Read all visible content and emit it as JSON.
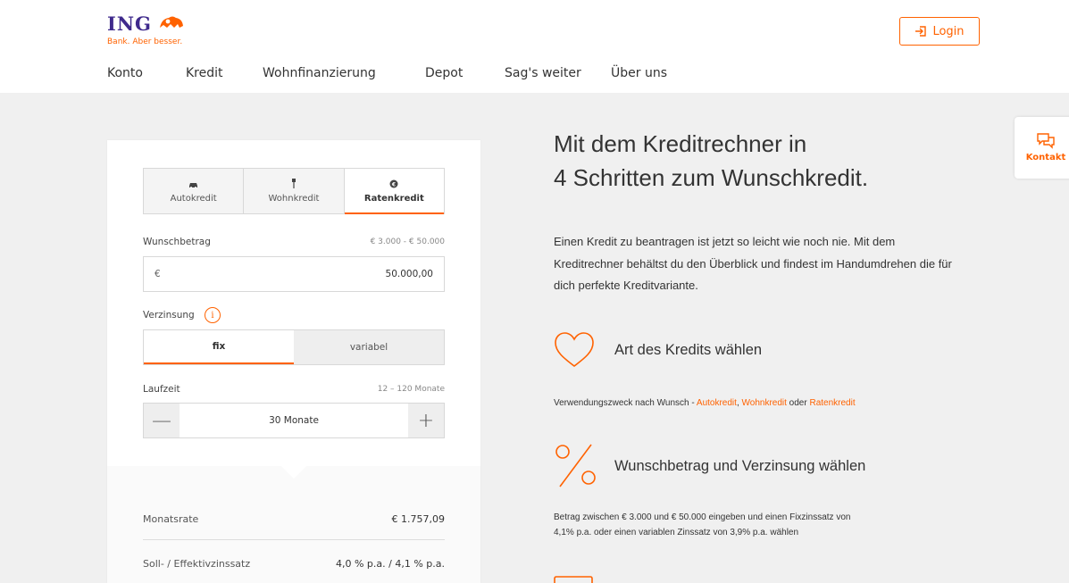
{
  "brand": {
    "name": "ING",
    "tagline": "Bank. Aber besser.",
    "accent": "#ff6200",
    "navy": "#3f2a8c"
  },
  "header": {
    "login_label": "Login",
    "nav": [
      "Konto",
      "Kredit",
      "Wohnfinanzierung",
      "Depot",
      "Sag's weiter",
      "Über uns"
    ]
  },
  "calculator": {
    "tabs": [
      {
        "label": "Autokredit",
        "icon": "car-icon"
      },
      {
        "label": "Wohnkredit",
        "icon": "home-icon"
      },
      {
        "label": "Ratenkredit",
        "icon": "coin-icon",
        "selected": true
      }
    ],
    "amount": {
      "label": "Wunschbetrag",
      "range": "€ 3.000 - € 50.000",
      "currency": "€",
      "value": "50.000,00"
    },
    "interest": {
      "label": "Verzinsung",
      "info": "i",
      "options": [
        "fix",
        "variabel"
      ],
      "selected": "fix"
    },
    "term": {
      "label": "Laufzeit",
      "range": "12 – 120 Monate",
      "value": "30 Monate",
      "minus": "—",
      "plus": "+"
    },
    "results": [
      {
        "label": "Monatsrate",
        "value": "€ 1.757,09"
      },
      {
        "label": "Soll- / Effektivzinssatz",
        "value": "4,0 % p.a. / 4,1 % p.a."
      }
    ]
  },
  "content": {
    "headline_1": "Mit dem Kreditrechner in",
    "headline_2": "4 Schritten zum Wunschkredit.",
    "intro": "Einen Kredit zu beantragen ist jetzt so leicht wie noch nie. Mit dem Kreditrechner behältst du den Überblick und findest im Handumdrehen die für dich perfekte Kreditvariante.",
    "step1": {
      "title": "Art des Kredits wählen",
      "desc_prefix": "Verwendungszweck nach Wunsch - ",
      "link1": "Autokredit",
      "sep1": ", ",
      "link2": "Wohnkredit",
      "sep2": " oder ",
      "link3": "Ratenkredit"
    },
    "step2": {
      "title": "Wunschbetrag und Verzinsung wählen",
      "desc_line1": "Betrag zwischen € 3.000 und € 50.000 eingeben und einen Fixzinssatz von",
      "desc_line2": "4,1% p.a. oder einen variablen Zinssatz von 3,9% p.a. wählen"
    }
  },
  "kontakt": {
    "label": "Kontakt"
  }
}
